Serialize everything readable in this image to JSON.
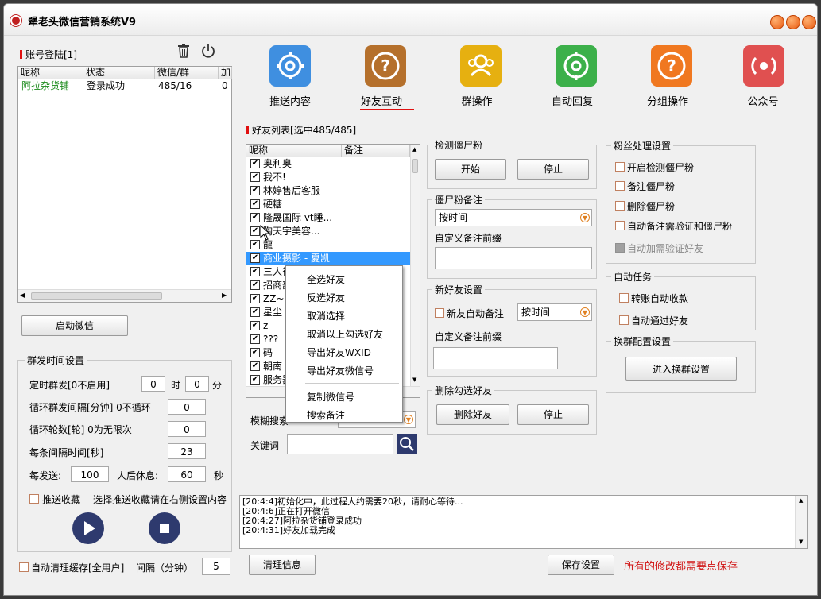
{
  "app": {
    "title": "犟老头微信营销系统V9"
  },
  "account": {
    "header": "账号登陆[1]",
    "columns": [
      "昵称",
      "状态",
      "微信/群",
      "加"
    ],
    "rows": [
      {
        "name": "阿拉杂货铺",
        "status": "登录成功",
        "count": "485/16",
        "add": "0"
      }
    ],
    "start_button": "启动微信"
  },
  "nav": [
    {
      "label": "推送内容",
      "color": "#3f8fe0",
      "icon": "gear-icon"
    },
    {
      "label": "好友互动",
      "color": "#b5702c",
      "icon": "question-icon"
    },
    {
      "label": "群操作",
      "color": "#e6b010",
      "icon": "users-icon"
    },
    {
      "label": "自动回复",
      "color": "#3cb04a",
      "icon": "target-icon"
    },
    {
      "label": "分组操作",
      "color": "#f07820",
      "icon": "question-icon"
    },
    {
      "label": "公众号",
      "color": "#e05050",
      "icon": "broadcast-icon"
    }
  ],
  "friends": {
    "header": "好友列表[选中485/485]",
    "columns": [
      "昵称",
      "备注"
    ],
    "rows": [
      "奥利奥",
      "我不!",
      "林婷售后客服",
      "硬糖",
      "隆晟国际 vt睡...",
      "陶天宇美容...",
      "龍",
      "商业摄影 - 夏凯",
      "三人行",
      "招商部",
      "ZZ~",
      "星尘",
      "z",
      "???",
      "码",
      "朝南",
      "服务器"
    ],
    "selected_index": 7
  },
  "context_menu": [
    "全选好友",
    "反选好友",
    "取消选择",
    "取消以上勾选好友",
    "导出好友WXID",
    "导出好友微信号",
    "复制微信号",
    "搜索备注"
  ],
  "search": {
    "mode_label": "模糊搜索",
    "keyword_label": "关键词",
    "keyword_value": ""
  },
  "zombie_check": {
    "title": "检测僵尸粉",
    "start": "开始",
    "stop": "停止"
  },
  "zombie_note": {
    "title": "僵尸粉备注",
    "select": "按时间",
    "prefix_label": "自定义备注前缀"
  },
  "new_friend": {
    "title": "新好友设置",
    "auto_note": "新友自动备注",
    "select": "按时间",
    "prefix_label": "自定义备注前缀"
  },
  "delete_selected": {
    "title": "删除勾选好友",
    "delete": "删除好友",
    "stop": "停止"
  },
  "fans": {
    "title": "粉丝处理设置",
    "options": [
      "开启检测僵尸粉",
      "备注僵尸粉",
      "删除僵尸粉",
      "自动备注需验证和僵尸粉"
    ],
    "disabled_option": "自动加需验证好友"
  },
  "auto_task": {
    "title": "自动任务",
    "options": [
      "转账自动收款",
      "自动通过好友"
    ]
  },
  "group_switch": {
    "title": "换群配置设置",
    "button": "进入换群设置"
  },
  "group_time": {
    "title": "群发时间设置",
    "timed_label": "定时群发[0不启用]",
    "hour_value": "0",
    "hour_unit": "时",
    "min_value": "0",
    "min_unit": "分",
    "interval_label": "循环群发间隔[分钟] 0不循环",
    "interval_value": "0",
    "rounds_label": "循环轮数[轮] 0为无限次",
    "rounds_value": "0",
    "gap_label": "每条间隔时间[秒]",
    "gap_value": "23",
    "per_send_label": "每发送:",
    "per_send_value": "100",
    "rest_label": "人后休息:",
    "rest_value": "60",
    "rest_unit": "秒",
    "push_fav_label": "推送收藏",
    "push_fav_hint": "选择推送收藏请在右侧设置内容"
  },
  "auto_clean": {
    "label": "自动清理缓存[全用户]",
    "interval_label": "间隔（分钟）",
    "interval_value": "5"
  },
  "log": [
    "[20:4:4]初始化中，此过程大约需要20秒，请耐心等待...",
    "[20:4:6]正在打开微信",
    "[20:4:27]阿拉杂货铺登录成功",
    "[20:4:31]好友加载完成"
  ],
  "footer": {
    "clear": "清理信息",
    "save": "保存设置",
    "save_hint": "所有的修改都需要点保存",
    "hint_color": "#d01010"
  }
}
